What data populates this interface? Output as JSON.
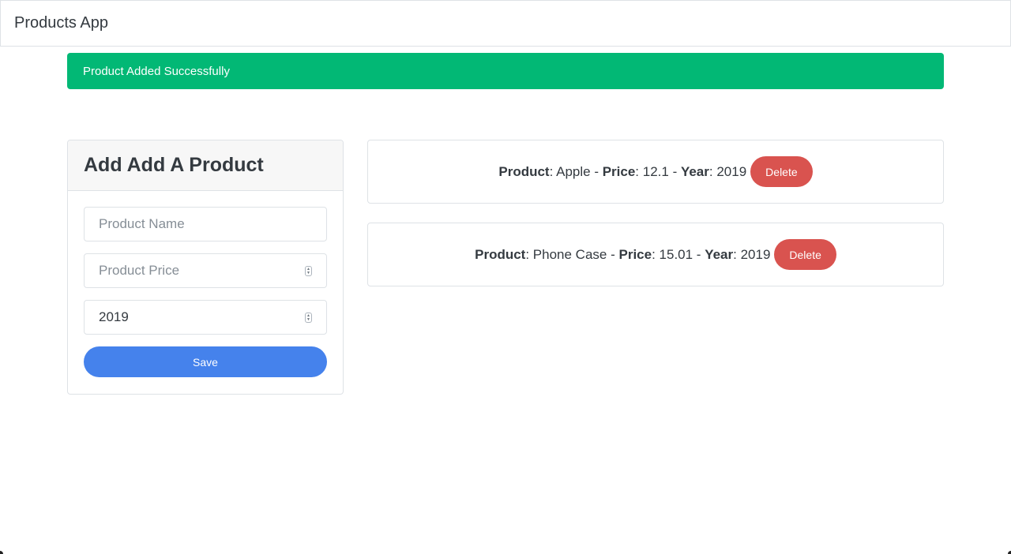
{
  "app": {
    "brand": "Products App"
  },
  "alert": {
    "message": "Product Added Successfully",
    "color": "#02b875"
  },
  "form": {
    "title": "Add Add A Product",
    "name_placeholder": "Product Name",
    "price_placeholder": "Product Price",
    "year_value": "2019",
    "save_label": "Save",
    "save_color": "#4582ec"
  },
  "products": [
    {
      "product_label": "Product",
      "name": "Apple",
      "price_label": "Price",
      "price": "12.1",
      "year_label": "Year",
      "year": "2019",
      "delete_label": "Delete"
    },
    {
      "product_label": "Product",
      "name": "Phone Case",
      "price_label": "Price",
      "price": "15.01",
      "year_label": "Year",
      "year": "2019",
      "delete_label": "Delete"
    }
  ],
  "colors": {
    "delete": "#d9534f"
  }
}
